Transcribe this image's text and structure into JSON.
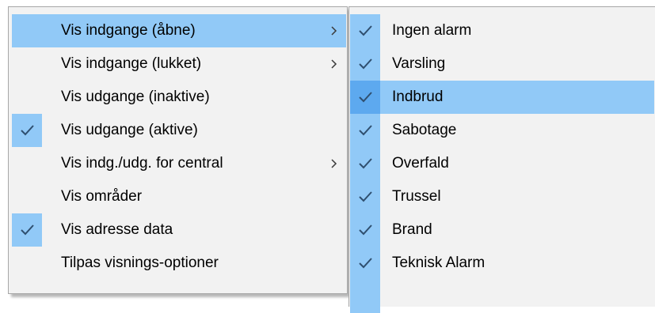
{
  "main_menu": {
    "items": [
      {
        "label": "Vis indgange (åbne)",
        "checked": false,
        "submenu": true,
        "highlighted": true
      },
      {
        "label": "Vis indgange (lukket)",
        "checked": false,
        "submenu": true,
        "highlighted": false
      },
      {
        "label": "Vis udgange (inaktive)",
        "checked": false,
        "submenu": false,
        "highlighted": false
      },
      {
        "label": "Vis udgange (aktive)",
        "checked": true,
        "submenu": false,
        "highlighted": false
      },
      {
        "label": "Vis indg./udg. for central",
        "checked": false,
        "submenu": true,
        "highlighted": false
      },
      {
        "label": "Vis områder",
        "checked": false,
        "submenu": false,
        "highlighted": false
      },
      {
        "label": "Vis adresse data",
        "checked": true,
        "submenu": false,
        "highlighted": false
      },
      {
        "label": "Tilpas visnings-optioner",
        "checked": false,
        "submenu": false,
        "highlighted": false
      }
    ]
  },
  "sub_menu": {
    "items": [
      {
        "label": "Ingen alarm",
        "checked": true,
        "highlighted": false
      },
      {
        "label": "Varsling",
        "checked": true,
        "highlighted": false
      },
      {
        "label": "Indbrud",
        "checked": true,
        "highlighted": true
      },
      {
        "label": "Sabotage",
        "checked": true,
        "highlighted": false
      },
      {
        "label": "Overfald",
        "checked": true,
        "highlighted": false
      },
      {
        "label": "Trussel",
        "checked": true,
        "highlighted": false
      },
      {
        "label": "Brand",
        "checked": true,
        "highlighted": false
      },
      {
        "label": "Teknisk Alarm",
        "checked": true,
        "highlighted": false
      }
    ]
  },
  "colors": {
    "menu_background": "#f2f2f2",
    "highlight": "#91c9f7",
    "check_box": "#91c9f7",
    "check_box_highlighted": "#5da9ef",
    "check_mark": "#2f4f6f",
    "border": "#a7a7a7"
  },
  "icons": {
    "check": "check-icon",
    "submenu": "chevron-right-icon"
  }
}
